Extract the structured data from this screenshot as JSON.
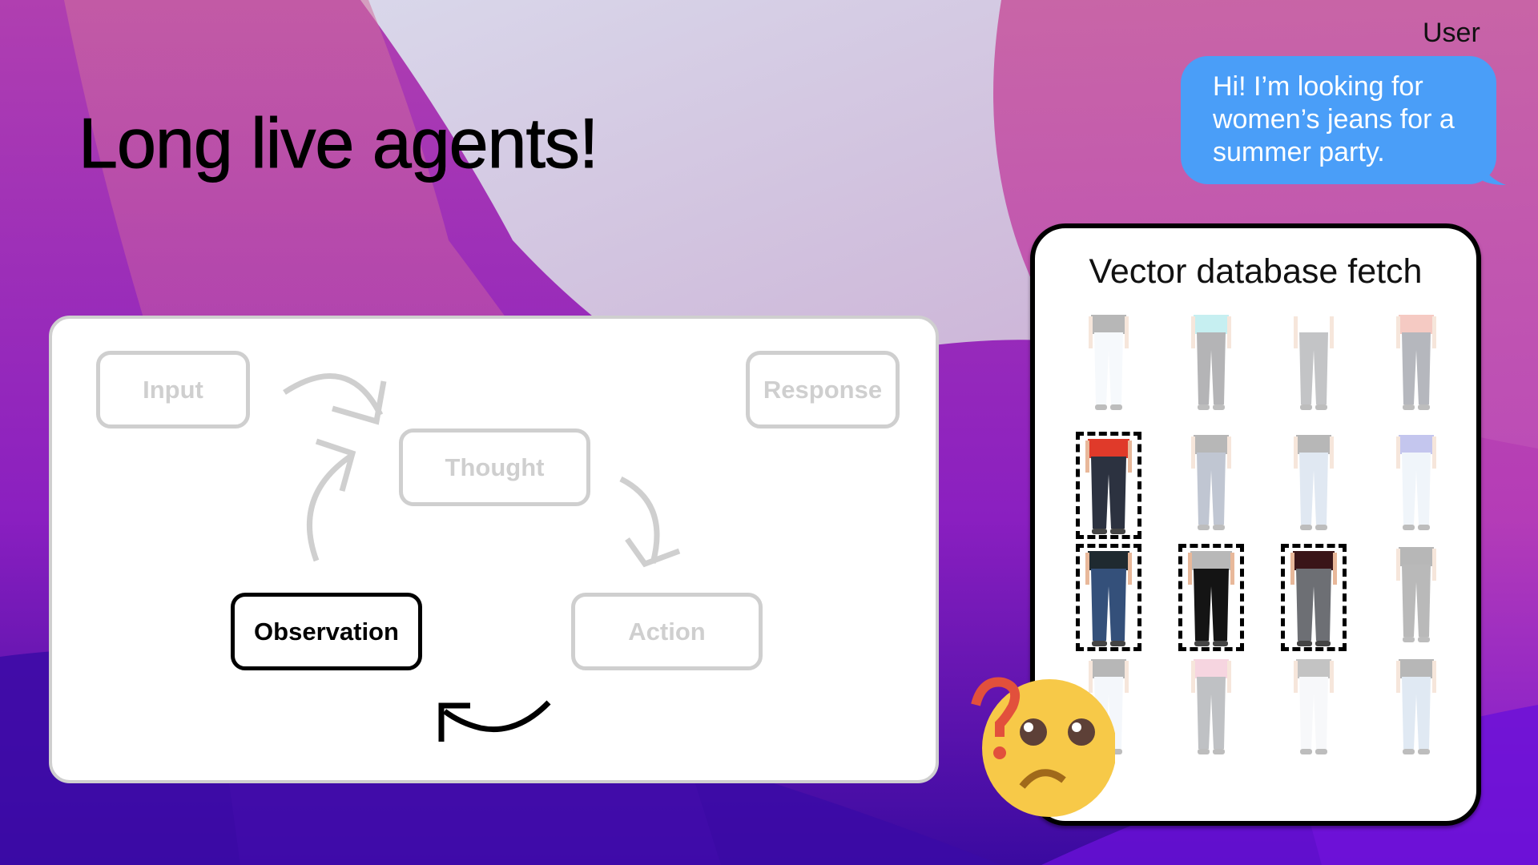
{
  "slide": {
    "title": "Long live agents!"
  },
  "diagram": {
    "nodes": [
      {
        "id": "input",
        "label": "Input",
        "state": "inactive"
      },
      {
        "id": "thought",
        "label": "Thought",
        "state": "inactive"
      },
      {
        "id": "response",
        "label": "Response",
        "state": "inactive"
      },
      {
        "id": "observation",
        "label": "Observation",
        "state": "active"
      },
      {
        "id": "action",
        "label": "Action",
        "state": "inactive"
      }
    ],
    "colors": {
      "inactive": "#cfcfcf",
      "active": "#000000"
    }
  },
  "chat": {
    "sender_label": "User",
    "message": "Hi! I’m looking for women’s jeans for a summer party.",
    "bubble_color": "#4a9ef8"
  },
  "vector_db": {
    "title": "Vector database fetch",
    "results": [
      {
        "row": 0,
        "col": 0,
        "gender": "women",
        "top": "#333333",
        "jeans": "#e6eef7",
        "selected": false
      },
      {
        "row": 0,
        "col": 1,
        "gender": "women",
        "top": "#5fd3d8",
        "jeans": "#2a2a30",
        "selected": false
      },
      {
        "row": 0,
        "col": 2,
        "gender": "women",
        "top": "#ffffff",
        "jeans": "#55595f",
        "selected": false
      },
      {
        "row": 0,
        "col": 3,
        "gender": "women",
        "top": "#e56a55",
        "jeans": "#2d3544",
        "selected": false
      },
      {
        "row": 1,
        "col": 0,
        "gender": "men",
        "top": "#e03a2a",
        "jeans": "#2c3240",
        "selected": true
      },
      {
        "row": 1,
        "col": 1,
        "gender": "women",
        "top": "#333333",
        "jeans": "#4d5d80",
        "selected": false
      },
      {
        "row": 1,
        "col": 2,
        "gender": "women",
        "top": "#333333",
        "jeans": "#a9c0dc",
        "selected": false
      },
      {
        "row": 1,
        "col": 3,
        "gender": "women",
        "top": "#5a5fd0",
        "jeans": "#d6e3f2",
        "selected": false
      },
      {
        "row": 2,
        "col": 0,
        "gender": "men",
        "top": "#1f2a30",
        "jeans": "#34507a",
        "selected": true
      },
      {
        "row": 2,
        "col": 1,
        "gender": "men",
        "top": "#b8b8b8",
        "jeans": "#141414",
        "selected": true
      },
      {
        "row": 2,
        "col": 2,
        "gender": "men",
        "top": "#3a1518",
        "jeans": "#6d6f74",
        "selected": true
      },
      {
        "row": 2,
        "col": 3,
        "gender": "women",
        "top": "#333333",
        "jeans": "#3a3a3a",
        "selected": false
      },
      {
        "row": 3,
        "col": 0,
        "gender": "women",
        "top": "#333333",
        "jeans": "#e0e9f4",
        "selected": false
      },
      {
        "row": 3,
        "col": 1,
        "gender": "women",
        "top": "#e68aa8",
        "jeans": "#4a4f58",
        "selected": false
      },
      {
        "row": 3,
        "col": 2,
        "gender": "women",
        "top": "#555555",
        "jeans": "#e9edf2",
        "selected": false
      },
      {
        "row": 3,
        "col": 3,
        "gender": "women",
        "top": "#333333",
        "jeans": "#a8c3de",
        "selected": false
      }
    ]
  },
  "reaction": {
    "icon": "confused-face-question-icon"
  }
}
